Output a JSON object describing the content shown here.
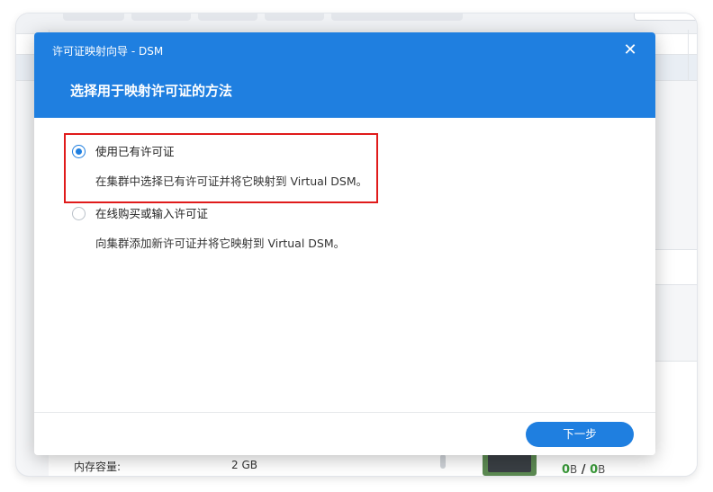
{
  "dialog": {
    "title": "许可证映射向导 - DSM",
    "heading": "选择用于映射许可证的方法",
    "close_icon": "close-icon",
    "options": [
      {
        "label": "使用已有许可证",
        "description": "在集群中选择已有许可证并将它映射到 Virtual DSM。",
        "selected": true
      },
      {
        "label": "在线购买或输入许可证",
        "description": "向集群添加新许可证并将它映射到 Virtual DSM。",
        "selected": false
      }
    ],
    "next_label": "下一步"
  },
  "background": {
    "memory_label": "内存容量:",
    "memory_value": "2 GB",
    "usage_used": "0",
    "usage_used_unit": "B",
    "usage_sep": " / ",
    "usage_total": "0",
    "usage_total_unit": "B"
  },
  "colors": {
    "accent": "#1f7fe0",
    "highlight": "#e01b1b",
    "usage_green": "#3a9a3a"
  }
}
